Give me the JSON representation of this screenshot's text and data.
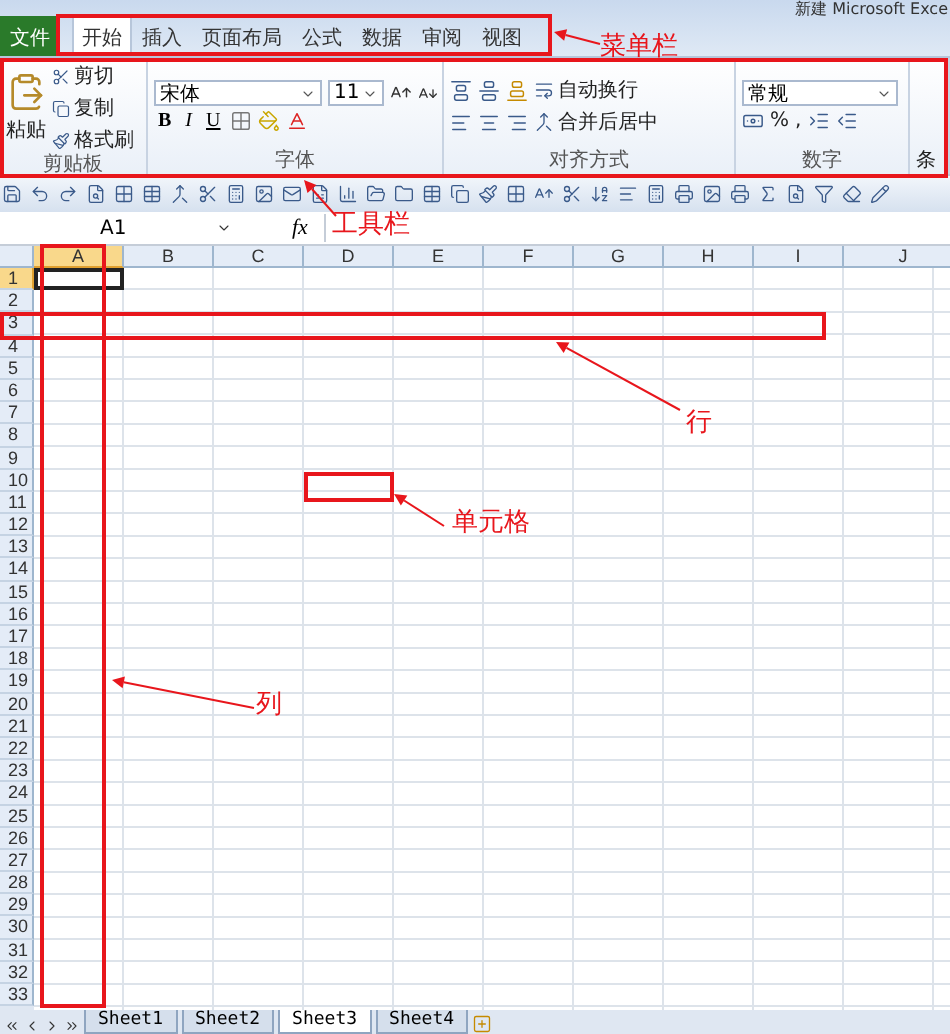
{
  "window": {
    "title": "新建 Microsoft Exce"
  },
  "menu_tabs": [
    {
      "label": "文件",
      "kind": "file",
      "selected": false
    },
    {
      "label": "开始",
      "kind": "tab",
      "selected": true
    },
    {
      "label": "插入",
      "kind": "tab",
      "selected": false
    },
    {
      "label": "页面布局",
      "kind": "tab",
      "selected": false
    },
    {
      "label": "公式",
      "kind": "tab",
      "selected": false
    },
    {
      "label": "数据",
      "kind": "tab",
      "selected": false
    },
    {
      "label": "审阅",
      "kind": "tab",
      "selected": false
    },
    {
      "label": "视图",
      "kind": "tab",
      "selected": false
    }
  ],
  "ribbon": {
    "clipboard": {
      "paste": "粘贴",
      "items": [
        "剪切",
        "复制",
        "格式刷"
      ],
      "group_label": "剪贴板"
    },
    "font": {
      "font_name": "宋体",
      "font_size": "11",
      "styles": [
        "B",
        "I",
        "U"
      ],
      "group_label": "字体"
    },
    "alignment": {
      "wrap": "自动换行",
      "merge": "合并后居中",
      "group_label": "对齐方式"
    },
    "number": {
      "format": "常规",
      "percent": "%",
      "comma": ",",
      "group_label": "数字"
    },
    "cut_group": "条"
  },
  "formula_bar": {
    "name_box": "A1",
    "fx": "fx"
  },
  "columns": [
    {
      "label": "A",
      "selected": true
    },
    {
      "label": "B",
      "selected": false
    },
    {
      "label": "C",
      "selected": false
    },
    {
      "label": "D",
      "selected": false
    },
    {
      "label": "E",
      "selected": false
    },
    {
      "label": "F",
      "selected": false
    },
    {
      "label": "G",
      "selected": false
    },
    {
      "label": "H",
      "selected": false
    },
    {
      "label": "I",
      "selected": false
    },
    {
      "label": "J",
      "selected": false
    }
  ],
  "rows": [
    {
      "label": "1",
      "selected": true
    },
    {
      "label": "2",
      "selected": false
    },
    {
      "label": "3",
      "selected": false
    },
    {
      "label": "4",
      "selected": false
    },
    {
      "label": "5",
      "selected": false
    },
    {
      "label": "6",
      "selected": false
    },
    {
      "label": "7",
      "selected": false
    },
    {
      "label": "8",
      "selected": false
    },
    {
      "label": "9",
      "selected": false
    },
    {
      "label": "10",
      "selected": false
    },
    {
      "label": "11",
      "selected": false
    },
    {
      "label": "12",
      "selected": false
    },
    {
      "label": "13",
      "selected": false
    },
    {
      "label": "14",
      "selected": false
    },
    {
      "label": "15",
      "selected": false
    },
    {
      "label": "16",
      "selected": false
    },
    {
      "label": "17",
      "selected": false
    },
    {
      "label": "18",
      "selected": false
    },
    {
      "label": "19",
      "selected": false
    },
    {
      "label": "20",
      "selected": false
    },
    {
      "label": "21",
      "selected": false
    },
    {
      "label": "22",
      "selected": false
    },
    {
      "label": "23",
      "selected": false
    },
    {
      "label": "24",
      "selected": false
    },
    {
      "label": "25",
      "selected": false
    },
    {
      "label": "26",
      "selected": false
    },
    {
      "label": "27",
      "selected": false
    },
    {
      "label": "28",
      "selected": false
    },
    {
      "label": "29",
      "selected": false
    },
    {
      "label": "30",
      "selected": false
    },
    {
      "label": "31",
      "selected": false
    },
    {
      "label": "32",
      "selected": false
    },
    {
      "label": "33",
      "selected": false
    }
  ],
  "sheets": [
    {
      "label": "Sheet1",
      "selected": false
    },
    {
      "label": "Sheet2",
      "selected": false
    },
    {
      "label": "Sheet3",
      "selected": true
    },
    {
      "label": "Sheet4",
      "selected": false
    }
  ],
  "annotations": [
    {
      "label": "菜单栏"
    },
    {
      "label": "工具栏"
    },
    {
      "label": "行"
    },
    {
      "label": "单元格"
    },
    {
      "label": "列"
    }
  ]
}
